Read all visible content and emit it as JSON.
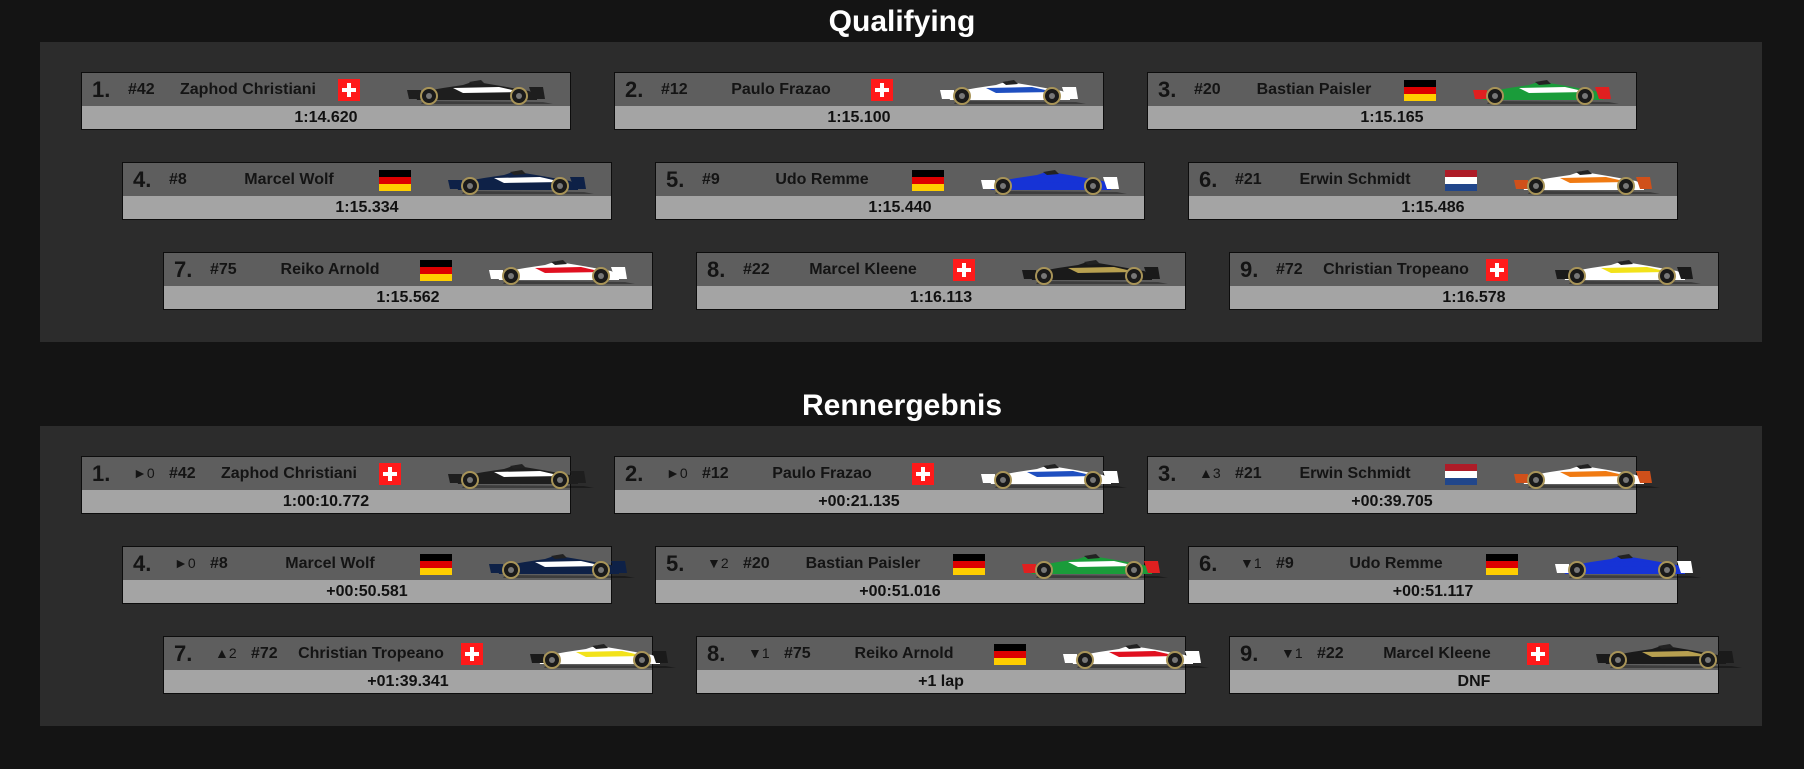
{
  "qualifying": {
    "title": "Qualifying",
    "entries": [
      {
        "pos": "1.",
        "num": "#42",
        "name": "Zaphod Christiani",
        "flag": "ch",
        "time": "1:14.620",
        "livery": [
          "#1e1e1e",
          "#ffffff",
          "#1e1e1e"
        ]
      },
      {
        "pos": "2.",
        "num": "#12",
        "name": "Paulo Frazao",
        "flag": "ch",
        "time": "1:15.100",
        "livery": [
          "#ffffff",
          "#1f4fc0",
          "#ffffff"
        ]
      },
      {
        "pos": "3.",
        "num": "#20",
        "name": "Bastian Paisler",
        "flag": "de",
        "time": "1:15.165",
        "livery": [
          "#1a9c3a",
          "#ffffff",
          "#e02020"
        ]
      },
      {
        "pos": "4.",
        "num": "#8",
        "name": "Marcel Wolf",
        "flag": "de",
        "time": "1:15.334",
        "livery": [
          "#0e2147",
          "#ffffff",
          "#0e2147"
        ]
      },
      {
        "pos": "5.",
        "num": "#9",
        "name": "Udo Remme",
        "flag": "de",
        "time": "1:15.440",
        "livery": [
          "#1633d6",
          "#1633d6",
          "#ffffff"
        ]
      },
      {
        "pos": "6.",
        "num": "#21",
        "name": "Erwin Schmidt",
        "flag": "nl",
        "time": "1:15.486",
        "livery": [
          "#ffffff",
          "#f07a12",
          "#d0501a"
        ]
      },
      {
        "pos": "7.",
        "num": "#75",
        "name": "Reiko Arnold",
        "flag": "de",
        "time": "1:15.562",
        "livery": [
          "#ffffff",
          "#e01020",
          "#ffffff"
        ]
      },
      {
        "pos": "8.",
        "num": "#22",
        "name": "Marcel Kleene",
        "flag": "ch",
        "time": "1:16.113",
        "livery": [
          "#1a1a1a",
          "#b8a050",
          "#1a1a1a"
        ]
      },
      {
        "pos": "9.",
        "num": "#72",
        "name": "Christian Tropeano",
        "flag": "ch",
        "time": "1:16.578",
        "livery": [
          "#ffffff",
          "#f2e21a",
          "#1a1a1a"
        ]
      }
    ]
  },
  "race": {
    "title": "Rennergebnis",
    "entries": [
      {
        "pos": "1.",
        "change": "►0",
        "num": "#42",
        "name": "Zaphod Christiani",
        "flag": "ch",
        "time": "1:00:10.772",
        "livery": [
          "#1e1e1e",
          "#ffffff",
          "#1e1e1e"
        ]
      },
      {
        "pos": "2.",
        "change": "►0",
        "num": "#12",
        "name": "Paulo Frazao",
        "flag": "ch",
        "time": "+00:21.135",
        "livery": [
          "#ffffff",
          "#1f4fc0",
          "#ffffff"
        ]
      },
      {
        "pos": "3.",
        "change": "▲3",
        "num": "#21",
        "name": "Erwin Schmidt",
        "flag": "nl",
        "time": "+00:39.705",
        "livery": [
          "#ffffff",
          "#f07a12",
          "#d0501a"
        ]
      },
      {
        "pos": "4.",
        "change": "►0",
        "num": "#8",
        "name": "Marcel Wolf",
        "flag": "de",
        "time": "+00:50.581",
        "livery": [
          "#0e2147",
          "#ffffff",
          "#0e2147"
        ]
      },
      {
        "pos": "5.",
        "change": "▼2",
        "num": "#20",
        "name": "Bastian Paisler",
        "flag": "de",
        "time": "+00:51.016",
        "livery": [
          "#1a9c3a",
          "#ffffff",
          "#e02020"
        ]
      },
      {
        "pos": "6.",
        "change": "▼1",
        "num": "#9",
        "name": "Udo Remme",
        "flag": "de",
        "time": "+00:51.117",
        "livery": [
          "#1633d6",
          "#1633d6",
          "#ffffff"
        ]
      },
      {
        "pos": "7.",
        "change": "▲2",
        "num": "#72",
        "name": "Christian Tropeano",
        "flag": "ch",
        "time": "+01:39.341",
        "livery": [
          "#ffffff",
          "#f2e21a",
          "#1a1a1a"
        ]
      },
      {
        "pos": "8.",
        "change": "▼1",
        "num": "#75",
        "name": "Reiko Arnold",
        "flag": "de",
        "time": "+1 lap",
        "livery": [
          "#ffffff",
          "#e01020",
          "#ffffff"
        ]
      },
      {
        "pos": "9.",
        "change": "▼1",
        "num": "#22",
        "name": "Marcel Kleene",
        "flag": "ch",
        "time": "DNF",
        "livery": [
          "#1a1a1a",
          "#b8a050",
          "#1a1a1a"
        ]
      }
    ]
  }
}
